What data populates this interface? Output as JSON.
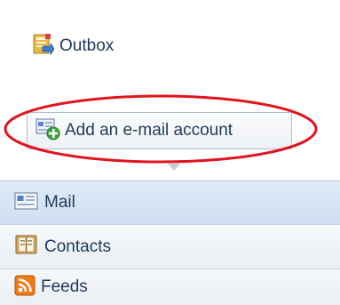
{
  "folders": {
    "outbox_label": "Outbox"
  },
  "add_account_button": {
    "label": "Add an e-mail account"
  },
  "navigation": {
    "items": [
      {
        "label": "Mail",
        "icon": "mail-icon"
      },
      {
        "label": "Contacts",
        "icon": "contacts-icon"
      },
      {
        "label": "Feeds",
        "icon": "feeds-icon"
      }
    ]
  },
  "colors": {
    "highlight_ellipse": "#e0141e",
    "text": "#1e395b",
    "feeds_icon": "#f07a14",
    "add_icon_plus": "#3aa53a"
  }
}
